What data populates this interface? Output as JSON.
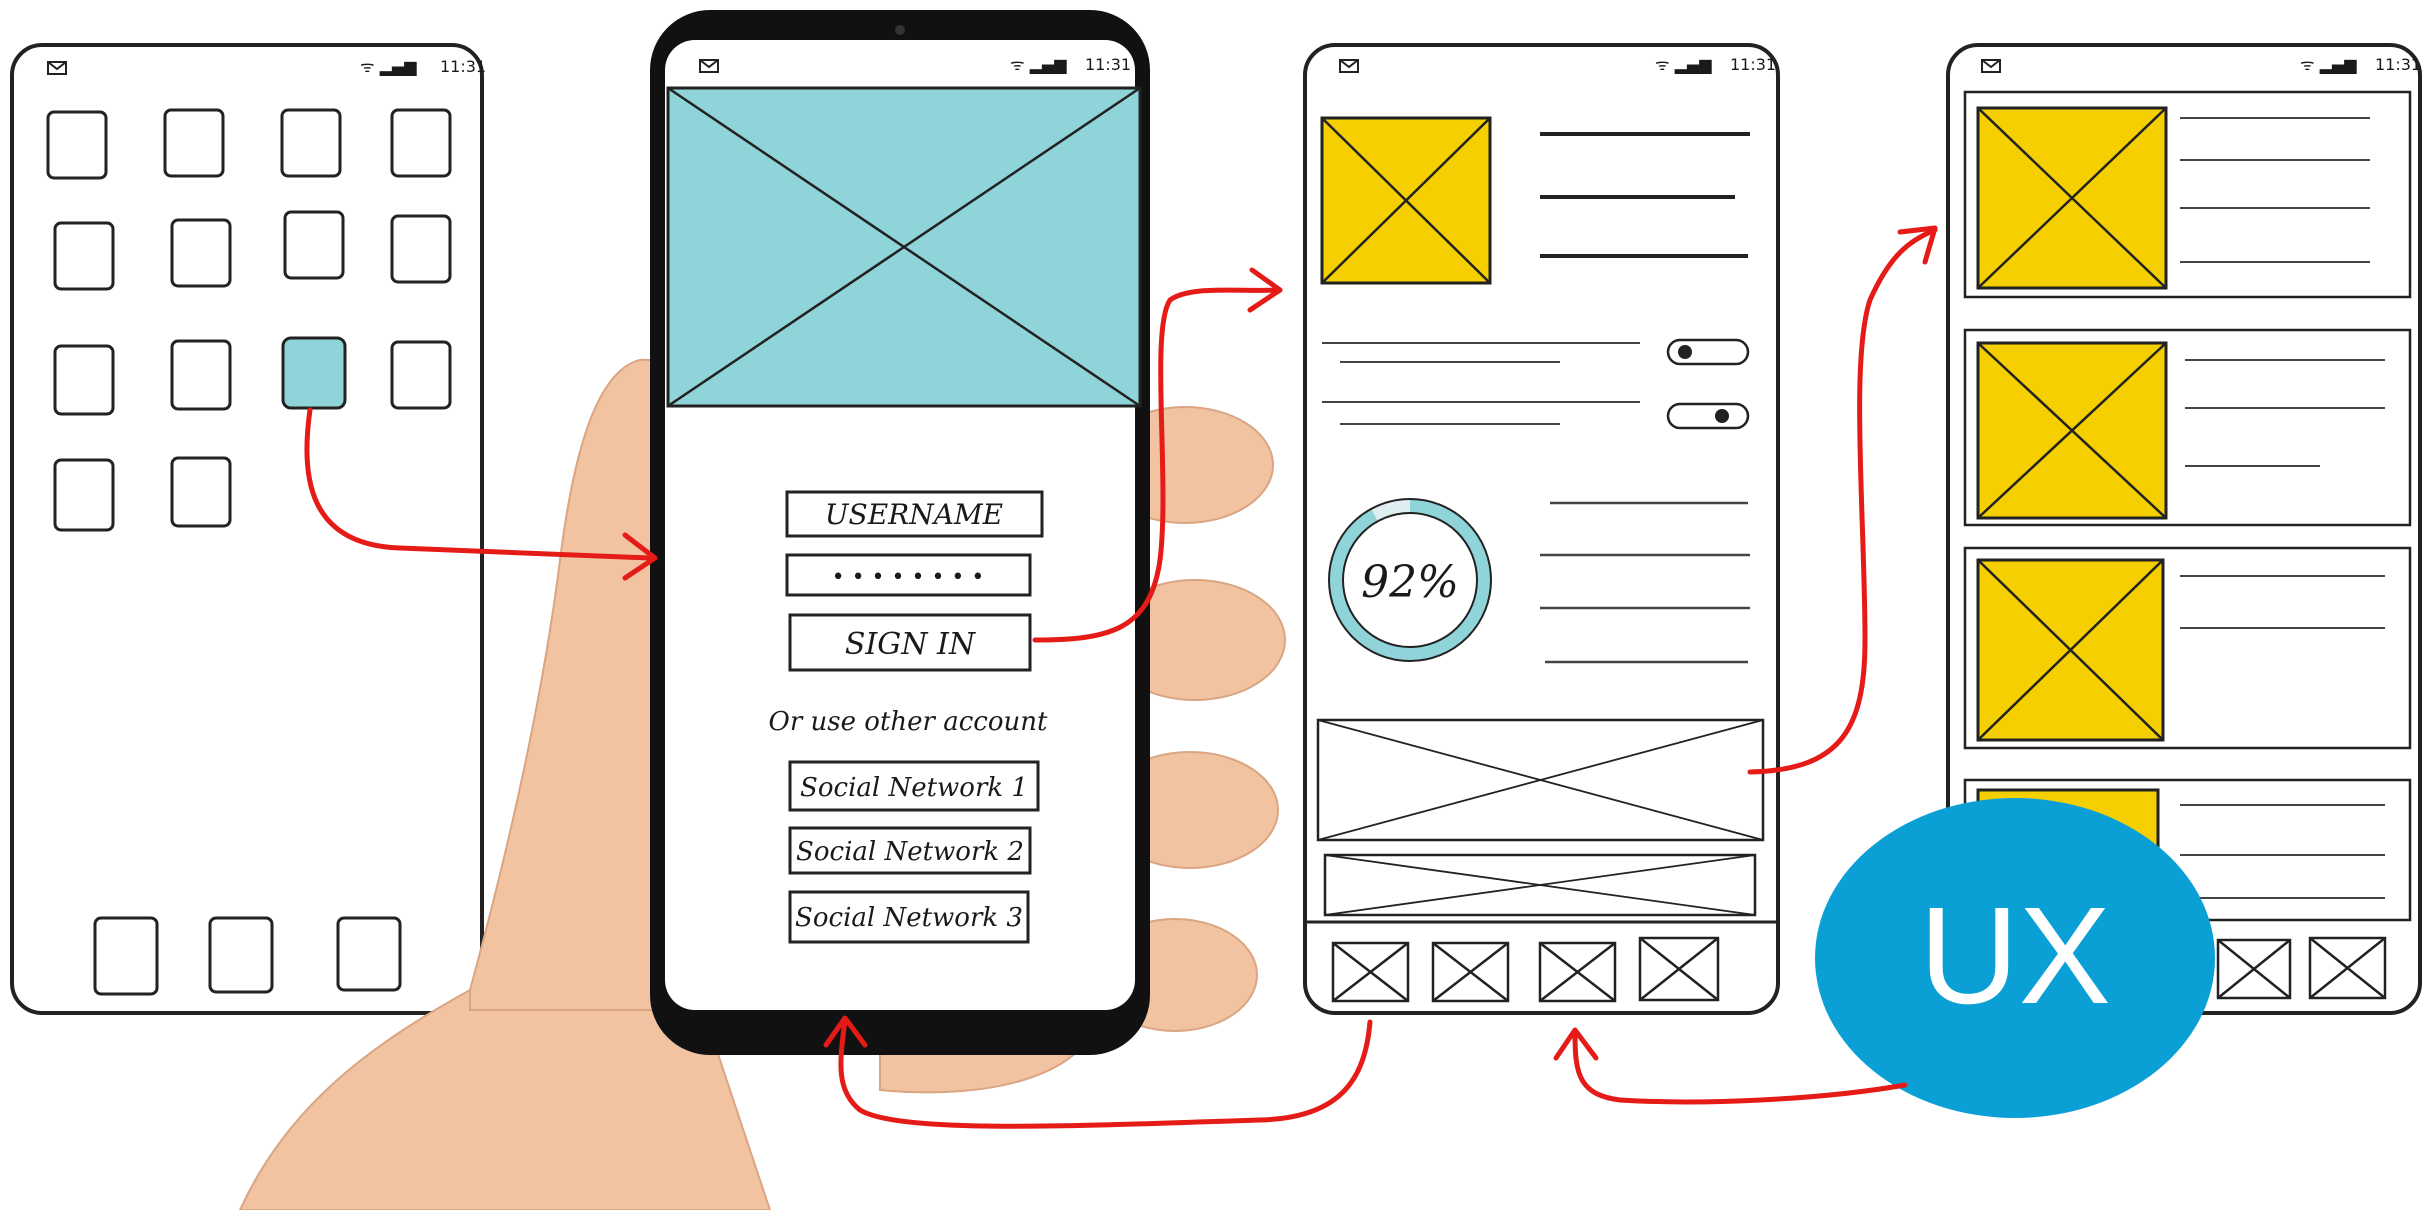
{
  "status_bar": {
    "time": "11:31",
    "signal": "ᯤ ▂▄▆"
  },
  "login_screen": {
    "username_placeholder": "USERNAME",
    "password_mask": "• • • • • • • •",
    "sign_in_label": "SIGN IN",
    "alt_prompt": "Or use other account",
    "social_buttons": [
      "Social Network 1",
      "Social Network 2",
      "Social Network 3"
    ]
  },
  "detail_screen": {
    "progress_label": "92%",
    "progress_value": 0.92
  },
  "badge": {
    "label": "UX",
    "color": "#0aa0d6"
  },
  "colors": {
    "accent_teal": "#8fd4d9",
    "accent_yellow": "#f5cf00",
    "arrow_red": "#e41b17",
    "skin": "#f1c3a0"
  }
}
